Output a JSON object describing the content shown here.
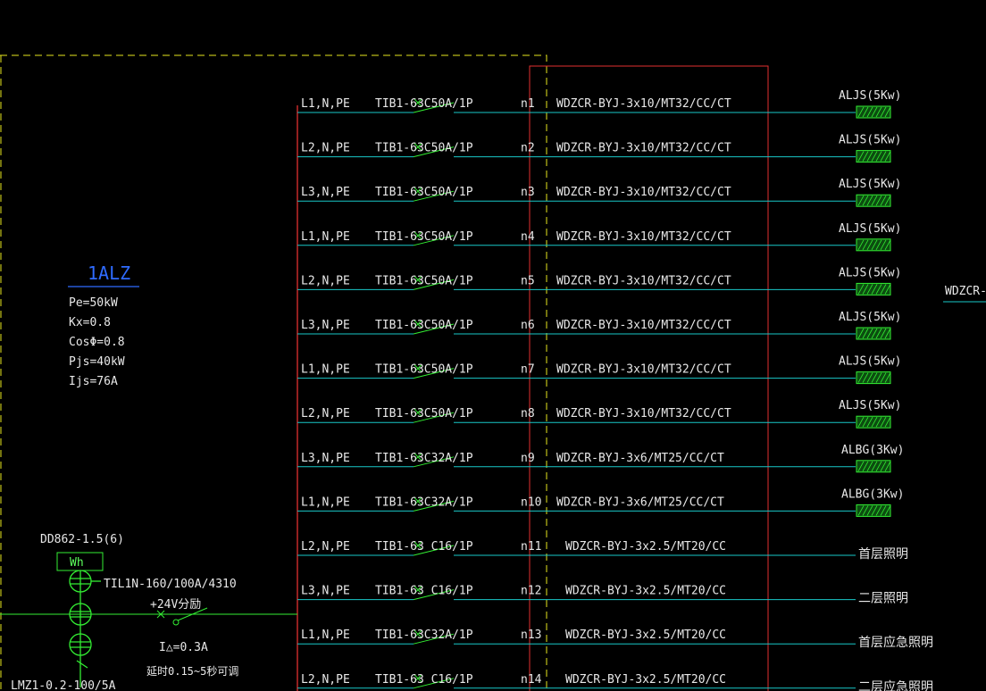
{
  "panel": {
    "name": "1ALZ",
    "params": [
      "Pe=50kW",
      "Kx=0.8",
      "CosΦ=0.8",
      "Pjs=40kW",
      "Ijs=76A"
    ]
  },
  "meter": {
    "model": "DD862-1.5(6)",
    "symbol": "Wh"
  },
  "main_breaker": "TIL1N-160/100A/4310",
  "shunt_trip": "+24V分励",
  "leakage": "I△=0.3A",
  "delay": "延时0.15~5秒可调",
  "ct": "LMZ1-0.2-100/5A",
  "outgoing_cable_partial": "WDZCR-",
  "circuits": [
    {
      "phase": "L1,N,PE",
      "breaker": "TIB1-63C50A/1P",
      "id": "n1",
      "cable": "WDZCR-BYJ-3x10/MT32/CC/CT",
      "load": "ALJS(5Kw)",
      "box": true
    },
    {
      "phase": "L2,N,PE",
      "breaker": "TIB1-63C50A/1P",
      "id": "n2",
      "cable": "WDZCR-BYJ-3x10/MT32/CC/CT",
      "load": "ALJS(5Kw)",
      "box": true
    },
    {
      "phase": "L3,N,PE",
      "breaker": "TIB1-63C50A/1P",
      "id": "n3",
      "cable": "WDZCR-BYJ-3x10/MT32/CC/CT",
      "load": "ALJS(5Kw)",
      "box": true
    },
    {
      "phase": "L1,N,PE",
      "breaker": "TIB1-63C50A/1P",
      "id": "n4",
      "cable": "WDZCR-BYJ-3x10/MT32/CC/CT",
      "load": "ALJS(5Kw)",
      "box": true
    },
    {
      "phase": "L2,N,PE",
      "breaker": "TIB1-63C50A/1P",
      "id": "n5",
      "cable": "WDZCR-BYJ-3x10/MT32/CC/CT",
      "load": "ALJS(5Kw)",
      "box": true
    },
    {
      "phase": "L3,N,PE",
      "breaker": "TIB1-63C50A/1P",
      "id": "n6",
      "cable": "WDZCR-BYJ-3x10/MT32/CC/CT",
      "load": "ALJS(5Kw)",
      "box": true
    },
    {
      "phase": "L1,N,PE",
      "breaker": "TIB1-63C50A/1P",
      "id": "n7",
      "cable": "WDZCR-BYJ-3x10/MT32/CC/CT",
      "load": "ALJS(5Kw)",
      "box": true
    },
    {
      "phase": "L2,N,PE",
      "breaker": "TIB1-63C50A/1P",
      "id": "n8",
      "cable": "WDZCR-BYJ-3x10/MT32/CC/CT",
      "load": "ALJS(5Kw)",
      "box": true
    },
    {
      "phase": "L3,N,PE",
      "breaker": "TIB1-63C32A/1P",
      "id": "n9",
      "cable": "WDZCR-BYJ-3x6/MT25/CC/CT",
      "load": "ALBG(3Kw)",
      "box": true
    },
    {
      "phase": "L1,N,PE",
      "breaker": "TIB1-63C32A/1P",
      "id": "n10",
      "cable": "WDZCR-BYJ-3x6/MT25/CC/CT",
      "load": "ALBG(3Kw)",
      "box": true
    },
    {
      "phase": "L2,N,PE",
      "breaker": "TIB1-63 C16/1P",
      "id": "n11",
      "cable": "WDZCR-BYJ-3x2.5/MT20/CC",
      "load": "首层照明",
      "box": false
    },
    {
      "phase": "L3,N,PE",
      "breaker": "TIB1-63 C16/1P",
      "id": "n12",
      "cable": "WDZCR-BYJ-3x2.5/MT20/CC",
      "load": "二层照明",
      "box": false
    },
    {
      "phase": "L1,N,PE",
      "breaker": "TIB1-63C32A/1P",
      "id": "n13",
      "cable": "WDZCR-BYJ-3x2.5/MT20/CC",
      "load": "首层应急照明",
      "box": false
    },
    {
      "phase": "L2,N,PE",
      "breaker": "TIB1-63 C16/1P",
      "id": "n14",
      "cable": "WDZCR-BYJ-3x2.5/MT20/CC",
      "load": "二层应急照明",
      "box": false
    }
  ],
  "colors": {
    "background": "#000000",
    "text": "#e8e8e8",
    "feeder_line": "#19c8c8",
    "symbol": "#33ee33",
    "busbar": "#e23030",
    "dashed_frame": "#e6e61e",
    "panel_label": "#2f6bff"
  }
}
